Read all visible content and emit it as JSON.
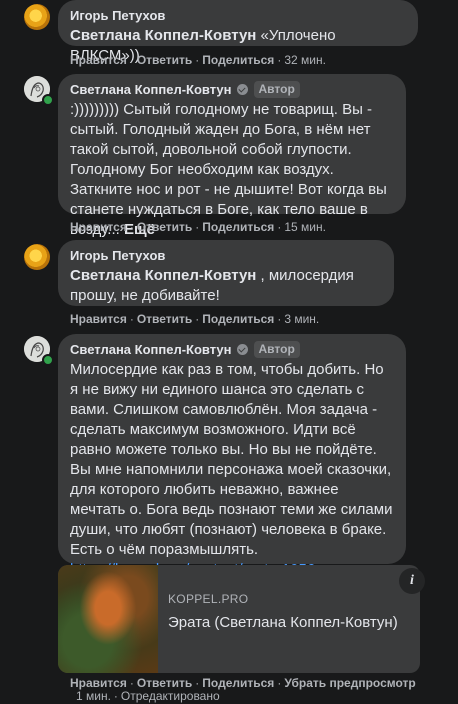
{
  "comments": [
    {
      "author": "Игорь Петухов",
      "mention": "Светлана Коппел-Ковтун",
      "text": " «Уплочено ВЛКСМ»))",
      "time": "32 мин."
    },
    {
      "author": "Светлана Коппел-Ковтун",
      "badge": "Автор",
      "text": ":))))))))) Сытый голодному не товарищ. Вы - сытый. Голодный жаден до Бога, в нём нет такой сытой, довольной собой глупости. Голодному Бог необходим как воздух. Заткните нос и рот - не дышите! Вот когда вы станете нуждаться в Боге, как тело ваше в возду...",
      "more": "Ещё",
      "time": "15 мин."
    },
    {
      "author": "Игорь Петухов",
      "mention": "Светлана Коппел-Ковтун",
      "text": " , милосердия прошу, не добивайте!",
      "time": "3 мин."
    },
    {
      "author": "Светлана Коппел-Ковтун",
      "badge": "Автор",
      "text": "Милосердие как раз в том, чтобы добить. Но я не вижу ни единого шанса это сделать с вами. Слишком самовлюблён. Моя задача - сделать максимум возможного. Идти всё равно можете только вы. Но вы не пойдёте. Вы мне напомнили персонажа моей сказочки, для которого любить неважно, важнее мечтать о. Бога ведь познают теми же силами души, что любят (познают) человека в браке. Есть о чём поразмышлять. ",
      "link": "https://koppel.pro/content/erata-1056",
      "time": "1 мин.",
      "edited": "Отредактировано"
    }
  ],
  "actions": {
    "like": "Нравится",
    "reply": "Ответить",
    "share": "Поделиться",
    "remove_preview": "Убрать предпросмотр",
    "sep": "·"
  },
  "preview": {
    "source": "KOPPEL.PRO",
    "title": "Эрата (Светлана Коппел-Ковтун)",
    "info": "i"
  },
  "colors": {
    "background": "#18191a",
    "bubble": "#3a3b3c",
    "text": "#e4e6eb",
    "secondary": "#b0b3b8",
    "link": "#4599ff",
    "online": "#31a24c"
  }
}
